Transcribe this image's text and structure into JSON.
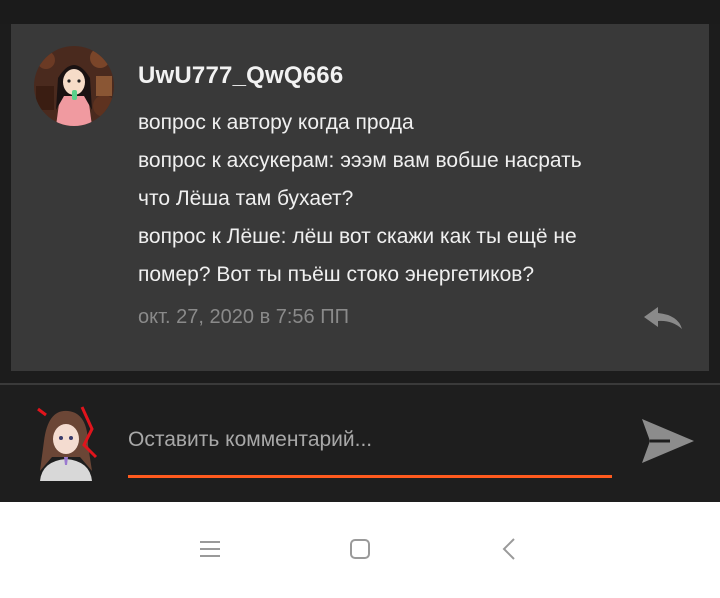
{
  "comment": {
    "username": "UwU777_QwQ666",
    "lines": [
      "вопрос к автору когда прода",
      "вопрос к ахсукерам: эээм вам вобше насрать",
      "что Лёша там бухает?",
      "вопрос к Лёше: лёш вот скажи как ты ещё не",
      "помер? Вот ты пъёш стоко энергетиков?"
    ],
    "timestamp": "окт. 27, 2020 в 7:56 ПП"
  },
  "composer": {
    "placeholder": "Оставить комментарий..."
  },
  "colors": {
    "accent": "#ff5a1e",
    "card_background": "#393939",
    "page_background": "#1e1e1e"
  },
  "icons": {
    "reply": "reply-icon",
    "send": "send-icon",
    "menu": "menu-icon",
    "home": "home-icon",
    "back": "back-icon"
  }
}
